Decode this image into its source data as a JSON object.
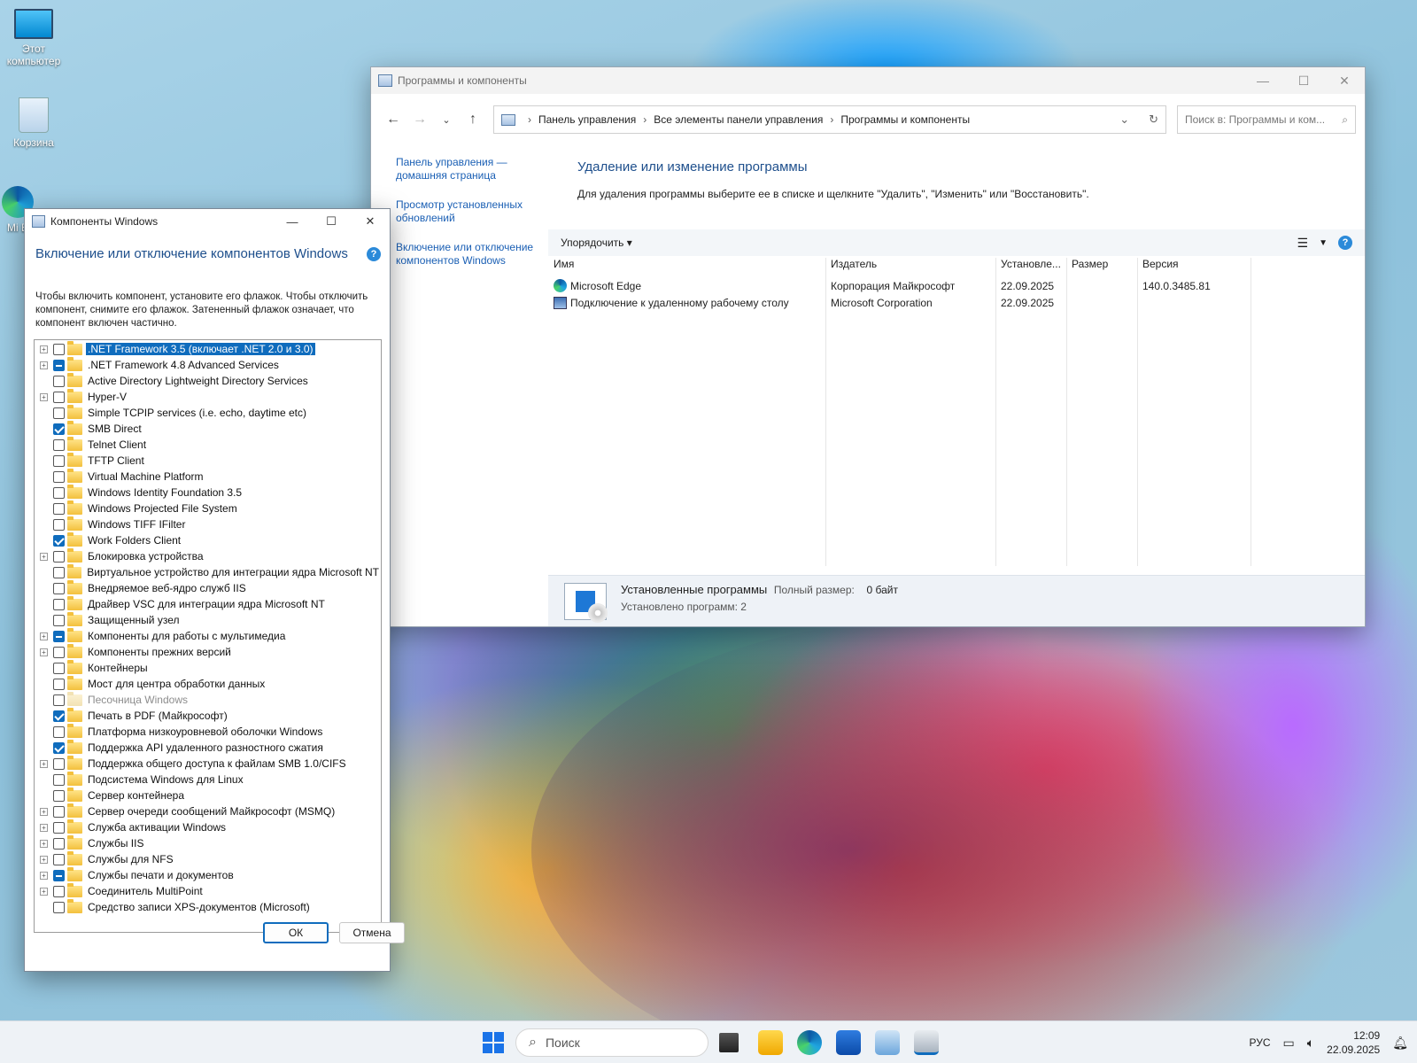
{
  "desktop": {
    "icons": [
      {
        "label": "Этот компьютер",
        "icon": "computer-icon"
      },
      {
        "label": "Корзина",
        "icon": "recycle-bin-icon"
      },
      {
        "label": "Mi E",
        "icon": "edge-icon"
      }
    ]
  },
  "control_panel": {
    "title": "Программы и компоненты",
    "breadcrumbs": [
      "Панель управления",
      "Все элементы панели управления",
      "Программы и компоненты"
    ],
    "search_placeholder": "Поиск в: Программы и ком...",
    "sidebar": [
      "Панель управления — домашняя страница",
      "Просмотр установленных обновлений",
      "Включение или отключение компонентов Windows"
    ],
    "heading": "Удаление или изменение программы",
    "description": "Для удаления программы выберите ее в списке и щелкните \"Удалить\", \"Изменить\" или \"Восстановить\".",
    "organize_label": "Упорядочить",
    "help_label": "?",
    "columns": [
      "Имя",
      "Издатель",
      "Установле...",
      "Размер",
      "Версия"
    ],
    "programs": [
      {
        "name": "Microsoft Edge",
        "publisher": "Корпорация Майкрософт",
        "installed": "22.09.2025",
        "size": "",
        "version": "140.0.3485.81",
        "icon": "edge-icon"
      },
      {
        "name": "Подключение к удаленному рабочему столу",
        "publisher": "Microsoft Corporation",
        "installed": "22.09.2025",
        "size": "",
        "version": "",
        "icon": "remote-desktop-icon"
      }
    ],
    "status": {
      "title": "Установленные программы",
      "total_size_label": "Полный размер:",
      "total_size_value": "0 байт",
      "count_text": "Установлено программ: 2"
    }
  },
  "features_dialog": {
    "title": "Компоненты Windows",
    "heading": "Включение или отключение компонентов Windows",
    "help_label": "?",
    "description": "Чтобы включить компонент, установите его флажок. Чтобы отключить компонент, снимите его флажок. Затененный флажок означает, что компонент включен частично.",
    "items": [
      {
        "label": ".NET Framework 3.5 (включает .NET 2.0 и 3.0)",
        "state": "off",
        "expandable": true,
        "selected": true
      },
      {
        "label": ".NET Framework 4.8 Advanced Services",
        "state": "partial",
        "expandable": true
      },
      {
        "label": "Active Directory Lightweight Directory Services",
        "state": "off",
        "expandable": false
      },
      {
        "label": "Hyper-V",
        "state": "off",
        "expandable": true
      },
      {
        "label": "Simple TCPIP services (i.e. echo, daytime etc)",
        "state": "off",
        "expandable": false
      },
      {
        "label": "SMB Direct",
        "state": "on",
        "expandable": false
      },
      {
        "label": "Telnet Client",
        "state": "off",
        "expandable": false
      },
      {
        "label": "TFTP Client",
        "state": "off",
        "expandable": false
      },
      {
        "label": "Virtual Machine Platform",
        "state": "off",
        "expandable": false
      },
      {
        "label": "Windows Identity Foundation 3.5",
        "state": "off",
        "expandable": false
      },
      {
        "label": "Windows Projected File System",
        "state": "off",
        "expandable": false
      },
      {
        "label": "Windows TIFF IFilter",
        "state": "off",
        "expandable": false
      },
      {
        "label": "Work Folders Client",
        "state": "on",
        "expandable": false
      },
      {
        "label": "Блокировка устройства",
        "state": "off",
        "expandable": true
      },
      {
        "label": "Виртуальное устройство для интеграции ядра Microsoft NT",
        "state": "off",
        "expandable": false
      },
      {
        "label": "Внедряемое веб-ядро служб IIS",
        "state": "off",
        "expandable": false
      },
      {
        "label": "Драйвер VSC для интеграции ядра Microsoft NT",
        "state": "off",
        "expandable": false
      },
      {
        "label": "Защищенный узел",
        "state": "off",
        "expandable": false
      },
      {
        "label": "Компоненты для работы с мультимедиа",
        "state": "partial",
        "expandable": true
      },
      {
        "label": "Компоненты прежних версий",
        "state": "off",
        "expandable": true
      },
      {
        "label": "Контейнеры",
        "state": "off",
        "expandable": false
      },
      {
        "label": "Мост для центра обработки данных",
        "state": "off",
        "expandable": false
      },
      {
        "label": "Песочница Windows",
        "state": "off",
        "expandable": false,
        "disabled": true
      },
      {
        "label": "Печать в PDF (Майкрософт)",
        "state": "on",
        "expandable": false
      },
      {
        "label": "Платформа низкоуровневой оболочки Windows",
        "state": "off",
        "expandable": false
      },
      {
        "label": "Поддержка API удаленного разностного сжатия",
        "state": "on",
        "expandable": false
      },
      {
        "label": "Поддержка общего доступа к файлам SMB 1.0/CIFS",
        "state": "off",
        "expandable": true
      },
      {
        "label": "Подсистема Windows для Linux",
        "state": "off",
        "expandable": false
      },
      {
        "label": "Сервер контейнера",
        "state": "off",
        "expandable": false
      },
      {
        "label": "Сервер очереди сообщений Майкрософт (MSMQ)",
        "state": "off",
        "expandable": true
      },
      {
        "label": "Служба активации Windows",
        "state": "off",
        "expandable": true
      },
      {
        "label": "Службы IIS",
        "state": "off",
        "expandable": true
      },
      {
        "label": "Службы для NFS",
        "state": "off",
        "expandable": true
      },
      {
        "label": "Службы печати и документов",
        "state": "partial",
        "expandable": true
      },
      {
        "label": "Соединитель MultiPoint",
        "state": "off",
        "expandable": true
      },
      {
        "label": "Средство записи XPS-документов (Microsoft)",
        "state": "off",
        "expandable": false
      }
    ],
    "ok_label": "ОК",
    "cancel_label": "Отмена"
  },
  "taskbar": {
    "search_placeholder": "Поиск",
    "language": "РУС",
    "time": "12:09",
    "date": "22.09.2025"
  }
}
